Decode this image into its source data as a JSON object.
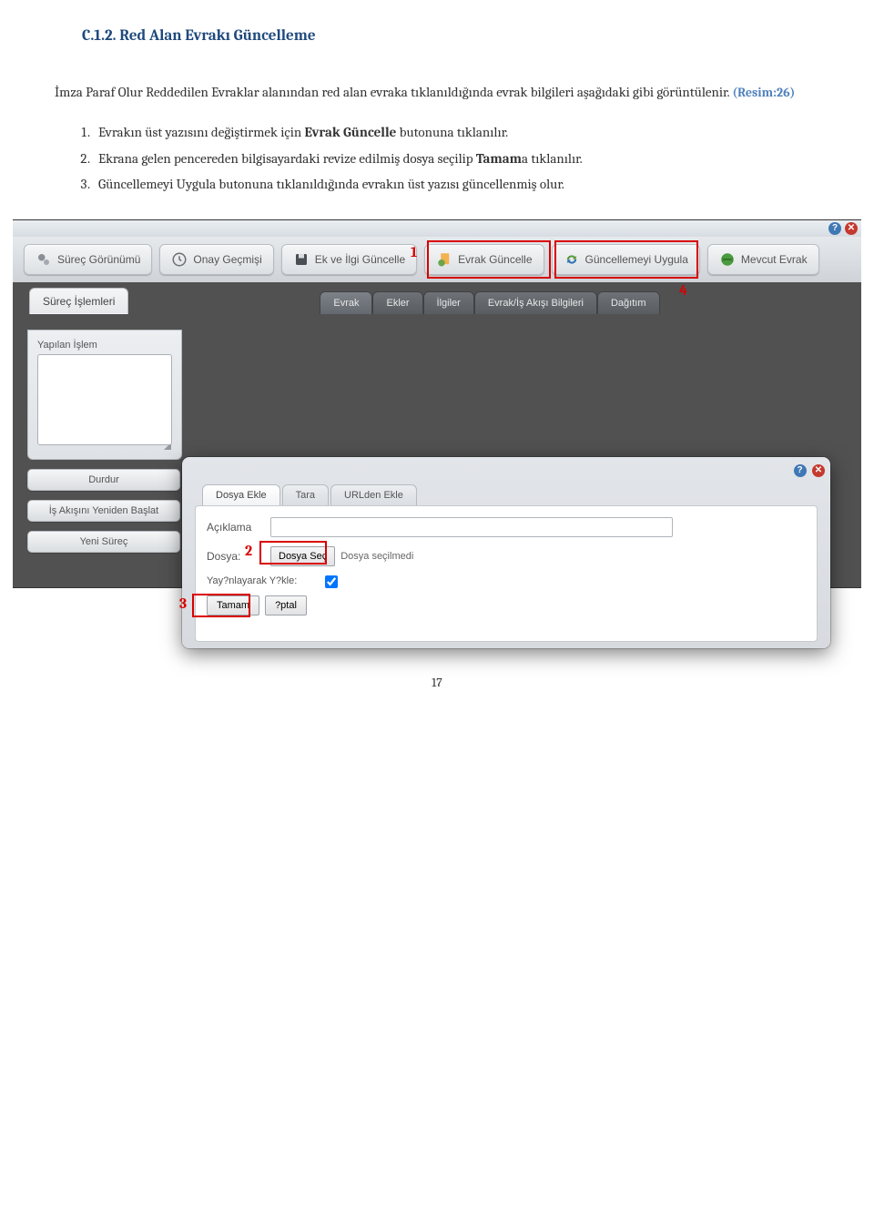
{
  "page": {
    "heading": "C.1.2. Red Alan Evrakı Güncelleme",
    "intro_plain": "İmza Paraf Olur Reddedilen Evraklar alanından red alan evraka tıklanıldığında evrak bilgileri aşağıdaki gibi görüntülenir. ",
    "intro_ref": "(Resim:26)",
    "list": [
      {
        "pre": "Evrakın üst yazısını değiştirmek için ",
        "bold": "Evrak Güncelle",
        "post": " butonuna tıklanılır."
      },
      {
        "pre": "Ekrana gelen pencereden bilgisayardaki revize edilmiş dosya seçilip ",
        "bold": "Tamam",
        "post": "a tıklanılır."
      },
      {
        "pre": "Güncellemeyi Uygula butonuna tıklanıldığında evrakın üst yazısı güncellenmiş olur.",
        "bold": "",
        "post": ""
      }
    ],
    "caption": "(Resim:26)",
    "page_number": "17"
  },
  "toolbar": {
    "surec_gorunumu": "Süreç Görünümü",
    "onay_gecmisi": "Onay Geçmişi",
    "ek_ilgi_guncelle": "Ek ve İlgi Güncelle",
    "evrak_guncelle": "Evrak Güncelle",
    "guncellemeyi_uygula": "Güncellemeyi Uygula",
    "mevcut_evrak": "Mevcut Evrak"
  },
  "tabs_main": [
    "Evrak",
    "Ekler",
    "İlgiler",
    "Evrak/İş Akışı Bilgileri",
    "Dağıtım"
  ],
  "left_panel": {
    "title": "Süreç İşlemleri",
    "field_label": "Yapılan İşlem",
    "buttons": [
      "Durdur",
      "İş Akışını Yeniden Başlat",
      "Yeni Süreç"
    ]
  },
  "dialog": {
    "tabs": [
      "Dosya Ekle",
      "Tara",
      "URLden Ekle"
    ],
    "fields": {
      "aciklama_label": "Açıklama",
      "dosya_label": "Dosya:",
      "dosya_sec_btn": "Dosya Seç",
      "dosya_status": "Dosya seçilmedi",
      "yayinlayarak_label": "Yay?nlayarak Y?kle:",
      "tamam": "Tamam",
      "iptal": "?ptal"
    }
  },
  "annotations": {
    "a1": "1",
    "a2": "2",
    "a3": "3",
    "a4": "4"
  },
  "icons": {
    "help": "?",
    "close": "✕"
  }
}
